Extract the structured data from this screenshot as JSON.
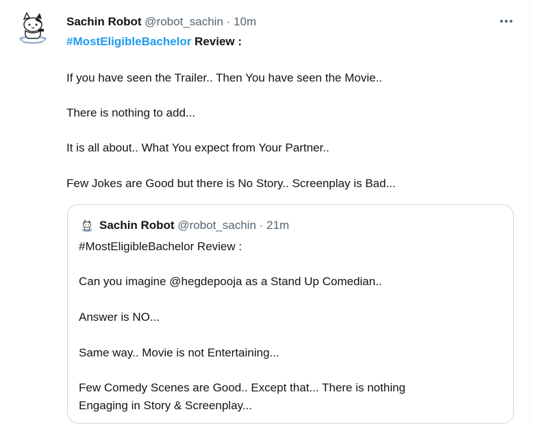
{
  "tweet": {
    "author_name": "Sachin Robot",
    "handle": "@robot_sachin",
    "separator": "·",
    "time": "10m",
    "more_icon": "more-horizontal-icon",
    "line1_hashtag": "#MostEligibleBachelor",
    "line1_rest": " Review :",
    "paragraphs": [
      "If you have seen the Trailer.. Then You have seen the Movie..",
      "There is nothing to add...",
      "It is all about.. What You expect from Your Partner..",
      "Few Jokes are Good but there is No Story.. Screenplay is Bad..."
    ]
  },
  "quote": {
    "author_name": "Sachin Robot",
    "handle": "@robot_sachin",
    "separator": "·",
    "time": "21m",
    "line1": "#MostEligibleBachelor Review :",
    "paragraphs": [
      "Can you imagine @hegdepooja as a Stand Up Comedian..",
      "Answer is NO...",
      "Same way.. Movie is not Entertaining...",
      "Few Comedy Scenes are Good.. Except that... There is nothing",
      "Engaging in Story & Screenplay..."
    ]
  },
  "colors": {
    "link": "#1d9bf0",
    "text": "#0f1419",
    "secondary": "#536471",
    "border": "#cfd9de"
  }
}
